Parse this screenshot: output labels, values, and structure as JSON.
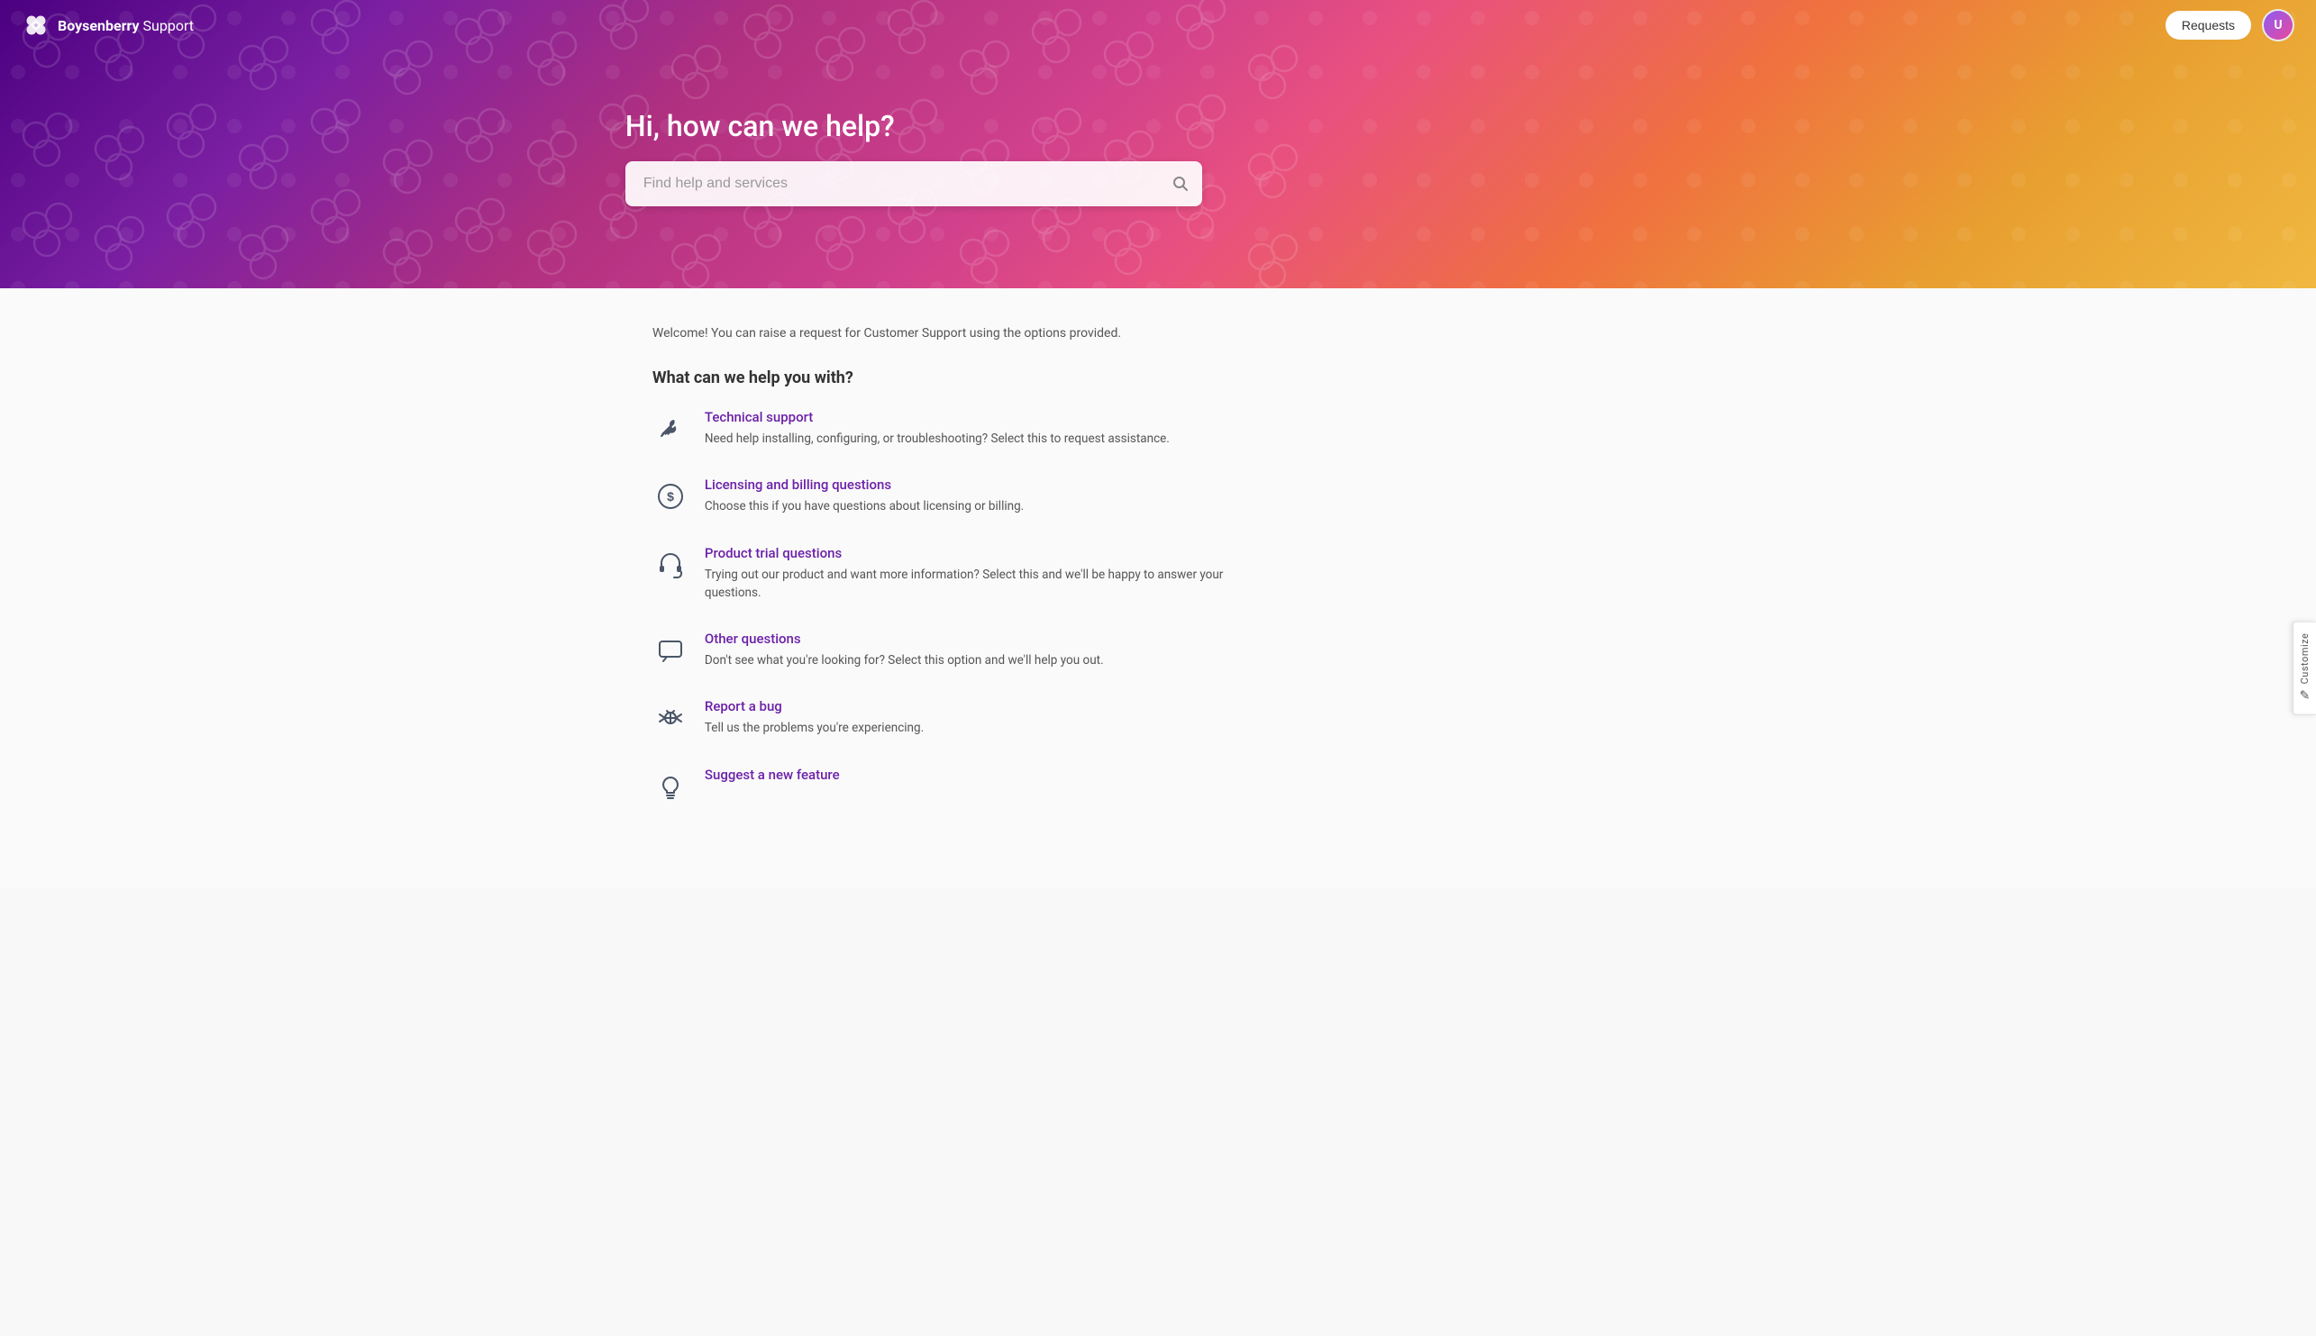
{
  "header": {
    "logo_brand": "Boysenberry",
    "logo_suffix": " Support",
    "requests_label": "Requests",
    "avatar_initials": "U"
  },
  "hero": {
    "title": "Hi, how can we help?",
    "search_placeholder": "Find help and services"
  },
  "customize_tab": {
    "label": "Customize",
    "icon": "✎"
  },
  "main": {
    "welcome_text": "Welcome! You can raise a request for Customer Support using the options provided.",
    "section_title": "What can we help you with?",
    "items": [
      {
        "id": "technical-support",
        "title": "Technical support",
        "description": "Need help installing, configuring, or troubleshooting? Select this to request assistance.",
        "icon": "wrench"
      },
      {
        "id": "licensing-billing",
        "title": "Licensing and billing questions",
        "description": "Choose this if you have questions about licensing or billing.",
        "icon": "dollar"
      },
      {
        "id": "product-trial",
        "title": "Product trial questions",
        "description": "Trying out our product and want more information? Select this and we'll be happy to answer your questions.",
        "icon": "headset"
      },
      {
        "id": "other-questions",
        "title": "Other questions",
        "description": "Don't see what you're looking for? Select this option and we'll help you out.",
        "icon": "chat"
      },
      {
        "id": "report-bug",
        "title": "Report a bug",
        "description": "Tell us the problems you're experiencing.",
        "icon": "bug"
      },
      {
        "id": "suggest-feature",
        "title": "Suggest a new feature",
        "description": "",
        "icon": "lightbulb"
      }
    ]
  }
}
